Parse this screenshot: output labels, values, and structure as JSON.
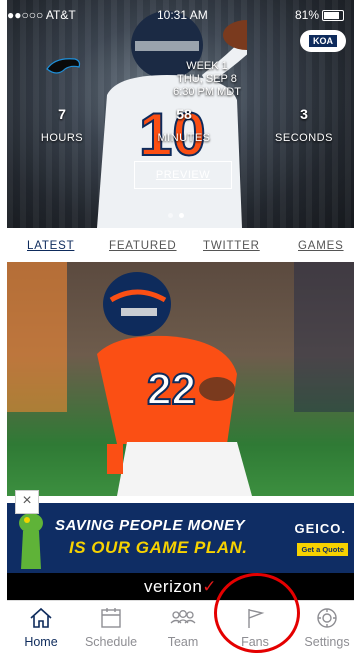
{
  "status_bar": {
    "carrier": "●●○○○ AT&T",
    "time": "10:31 AM",
    "battery": "81%"
  },
  "sponsor_badge": "KOA",
  "hero": {
    "game_info_line1": "WEEK 1",
    "game_info_line2": "THU, SEP 8",
    "game_info_line3": "6:30 PM MDT",
    "countdown": [
      {
        "value": "7",
        "unit": "HOURS"
      },
      {
        "value": "58",
        "unit": "MINUTES"
      },
      {
        "value": "3",
        "unit": "SECONDS"
      }
    ],
    "preview_label": "PREVIEW",
    "jersey_number": "10"
  },
  "tabs": [
    {
      "label": "LATEST",
      "active": true
    },
    {
      "label": "FEATURED",
      "active": false
    },
    {
      "label": "TWITTER",
      "active": false
    },
    {
      "label": "GAMES",
      "active": false
    }
  ],
  "news": {
    "jersey_number": "22"
  },
  "ad": {
    "close": "×",
    "line1": "SAVING PEOPLE MONEY",
    "line2": "IS OUR GAME PLAN.",
    "brand": "GEICO.",
    "cta": "Get a Quote",
    "sponsor_prefix": "verizon",
    "sponsor_check": "✓"
  },
  "nav": [
    {
      "label": "Home",
      "icon": "home-icon",
      "active": true
    },
    {
      "label": "Schedule",
      "icon": "calendar-icon",
      "active": false
    },
    {
      "label": "Team",
      "icon": "team-icon",
      "active": false
    },
    {
      "label": "Fans",
      "icon": "flag-icon",
      "active": false
    },
    {
      "label": "Settings",
      "icon": "gear-icon",
      "active": false
    }
  ],
  "colors": {
    "brand_navy": "#0e2b5c",
    "broncos_orange": "#fb4f14",
    "ad_yellow": "#f7d200",
    "annotation_red": "#e40000"
  }
}
